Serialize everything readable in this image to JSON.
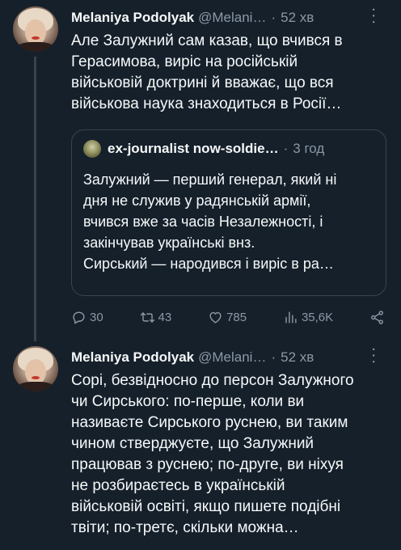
{
  "tweets": [
    {
      "author": {
        "name": "Melaniya Podolyak",
        "handle": "@Melani…",
        "time": "52 хв"
      },
      "more": "···",
      "text": "Але Залужний сам казав, що вчився в\nГерасимова, виріс на російській\nвійськовій доктрині й вважає, що вся\nвійськова наука знаходиться в Росії…",
      "quote": {
        "name": "ex-journalist now-soldie…",
        "time": "3 год",
        "text": "Залужний — перший генерал, який ні\nдня не служив у радянській армії,\nвчився вже за часів Незалежності, і\nзакінчував українські внз.\nСирський — народився і виріс в ра…"
      },
      "actions": {
        "replies": "30",
        "retweets": "43",
        "likes": "785",
        "views": "35,6K"
      }
    },
    {
      "author": {
        "name": "Melaniya Podolyak",
        "handle": "@Melani…",
        "time": "52 хв"
      },
      "more": "···",
      "text": "Сорі, безвідносно до персон Залужного\nчи Сирського: по-перше, коли ви\nназиваєте Сирського руснею, ви таким\nчином стверджуєте, що Залужний\nпрацював з руснею; по-друге, ви ніхуя\nне розбираєтесь в українській\nвійськовій освіті, якщо пишете подібні\nтвіти; по-третє, скільки можна…"
    }
  ],
  "separator": "·"
}
